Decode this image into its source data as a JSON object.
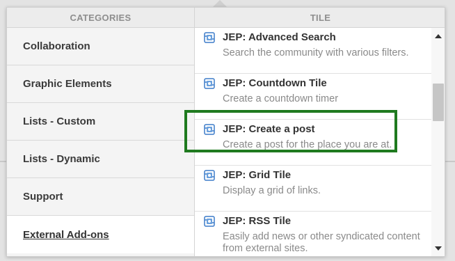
{
  "categories_header": "CATEGORIES",
  "tile_header": "TILE",
  "categories": [
    {
      "label": "Collaboration",
      "active": false
    },
    {
      "label": "Graphic Elements",
      "active": false
    },
    {
      "label": "Lists - Custom",
      "active": false
    },
    {
      "label": "Lists - Dynamic",
      "active": false
    },
    {
      "label": "Support",
      "active": false
    },
    {
      "label": "External Add-ons",
      "active": true
    }
  ],
  "tiles": [
    {
      "name": "JEP: Advanced Search",
      "desc": "Search the community with various filters."
    },
    {
      "name": "JEP: Countdown Tile",
      "desc": "Create a countdown timer"
    },
    {
      "name": "JEP: Create a post",
      "desc": "Create a post for the place you are at."
    },
    {
      "name": "JEP: Grid Tile",
      "desc": "Display a grid of links."
    },
    {
      "name": "JEP: RSS Tile",
      "desc": "Easily add news or other syndicated content from external sites."
    }
  ],
  "icons": {
    "tile": "puzzle-tile-icon"
  },
  "colors": {
    "highlight": "#1f7a1f",
    "tile_icon": "#3d7cc9"
  }
}
